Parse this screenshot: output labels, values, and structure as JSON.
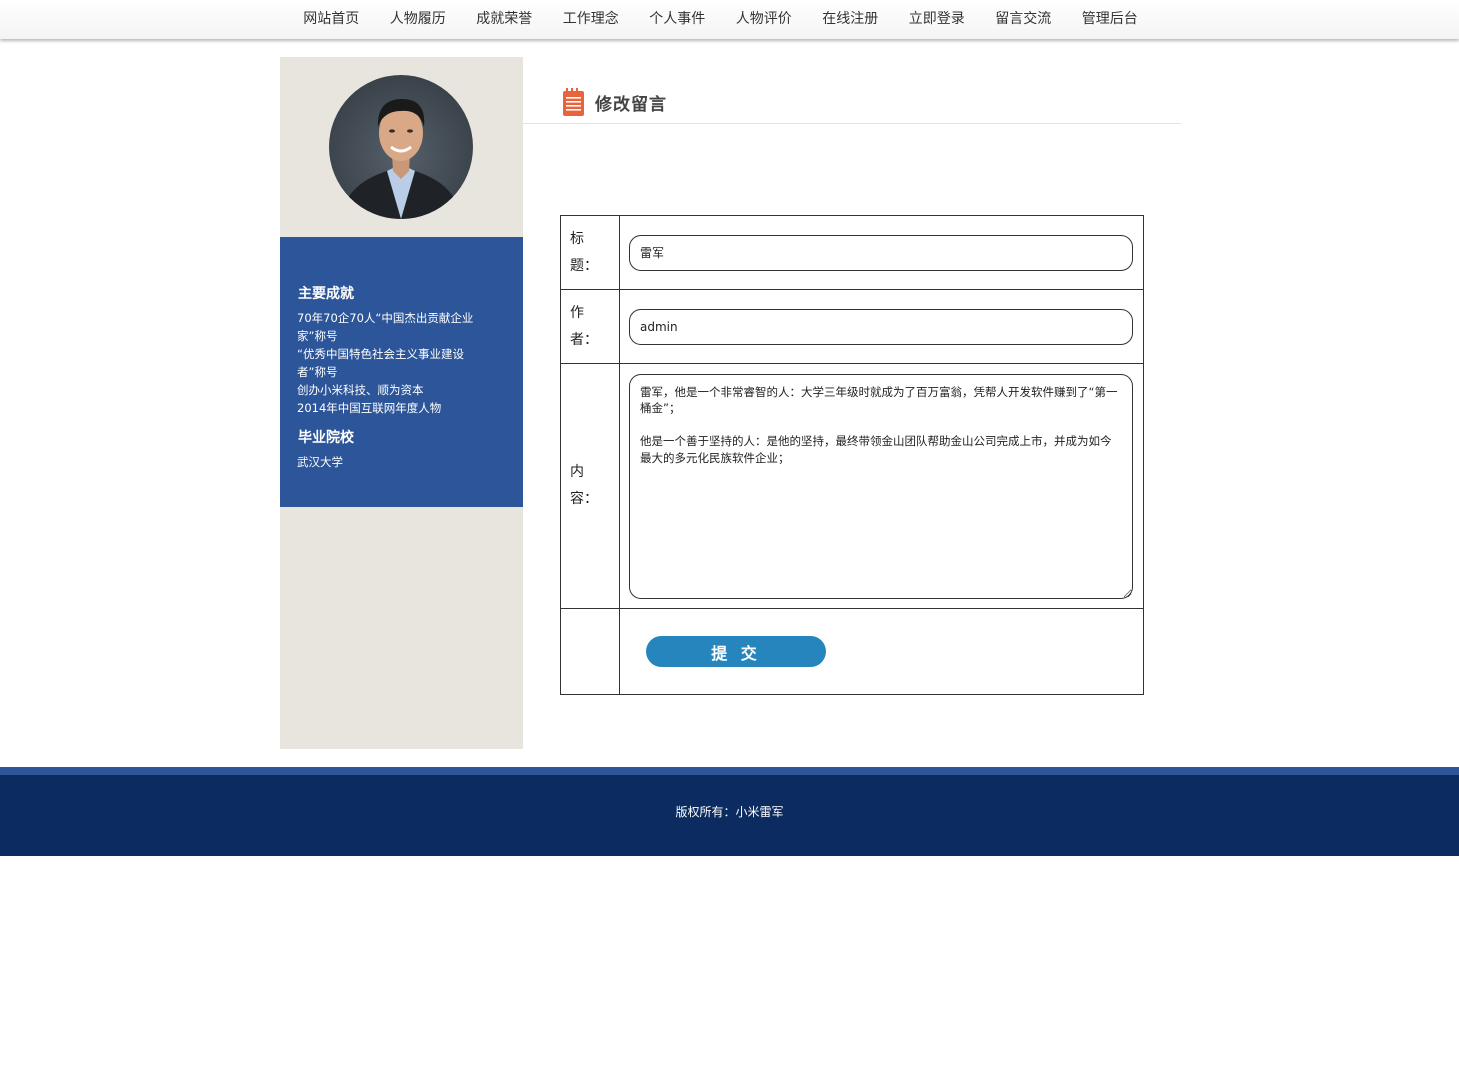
{
  "nav": {
    "items": [
      "网站首页",
      "人物履历",
      "成就荣誉",
      "工作理念",
      "个人事件",
      "人物评价",
      "在线注册",
      "立即登录",
      "留言交流",
      "管理后台"
    ]
  },
  "sidebar": {
    "achievements_title": "主要成就",
    "achievements": [
      "70年70企70人“中国杰出贡献企业家”称号",
      "“优秀中国特色社会主义事业建设者”称号",
      "创办小米科技、顺为资本",
      "2014年中国互联网年度人物"
    ],
    "school_title": "毕业院校",
    "school": "武汉大学"
  },
  "main": {
    "title": "修改留言",
    "form": {
      "title_label": "标题：",
      "title_value": "雷军",
      "author_label": "作者：",
      "author_value": "admin",
      "content_label": "内容：",
      "content_value": "雷军，他是一个非常睿智的人：大学三年级时就成为了百万富翁，凭帮人开发软件赚到了“第一桶金”；\n\n他是一个善于坚持的人：是他的坚持，最终带领金山团队帮助金山公司完成上市，并成为如今最大的多元化民族软件企业；",
      "submit_label": "提 交"
    }
  },
  "footer": {
    "copyright": "版权所有：小米雷军"
  },
  "colors": {
    "sidebar_bg": "#e8e5de",
    "sidebar_info_bg": "#2c5699",
    "footer_bg": "#0c2c61",
    "submit_bg": "#2785bd",
    "icon_accent": "#e8643c"
  }
}
